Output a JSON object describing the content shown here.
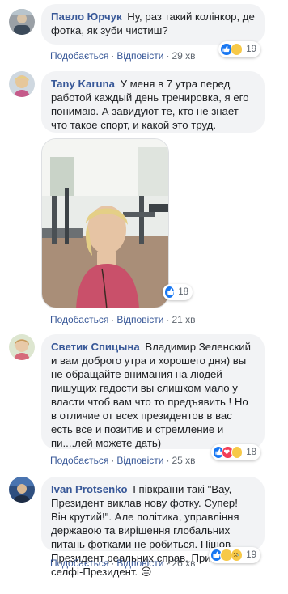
{
  "colors": {
    "link": "#385898",
    "bubble": "#f2f3f5",
    "muted": "#606770",
    "like": "#1877f2",
    "love": "#f33e58",
    "haha": "#f7c948"
  },
  "actions": {
    "like": "Подобається",
    "reply": "Відповісти",
    "separator": "·"
  },
  "comments": [
    {
      "author": "Павло Юрчук",
      "text": "Ну, раз такий колінкор, де фотка, як зуби чистиш?",
      "time": "29 хв",
      "reactions": [
        "like-icon",
        "haha-icon"
      ],
      "reaction_count": "19"
    },
    {
      "author": "Tany Karuna",
      "text": "У меня в 7 утра перед работой каждый день тренировка, я его понимаю. А завидуют те, кто не знает что такое спорт, и какой это труд.",
      "has_photo": true,
      "time": "21 хв",
      "reactions": [
        "like-icon"
      ],
      "reaction_count": "18"
    },
    {
      "author": "Светик Спицына",
      "text": "Владимир Зеленский и вам доброго утра и хорошего дня) вы не обращайте внимания на людей пишущих гадости вы слишком мало у власти чтоб вам что то предъявить ! Но в отличие от всех президентов в вас есть все и позитив и стремление и пи....лей можете дать)",
      "time": "25 хв",
      "reactions": [
        "like-icon",
        "love-icon",
        "haha-icon"
      ],
      "reaction_count": "18"
    },
    {
      "author": "Ivan Protsenko",
      "text": "І півкраїни такі \"Вау, Президент виклав нову фотку. Супер! Він крутий!\". Але політика, управління державою та вирішення глобальних питань фотками не робиться. Пішов Президент реальних справ. Прийшов селфі-Президент. 😑",
      "time": "26 хв",
      "reactions": [
        "like-icon",
        "haha-icon",
        "sad-icon"
      ],
      "reaction_count": "19"
    }
  ]
}
